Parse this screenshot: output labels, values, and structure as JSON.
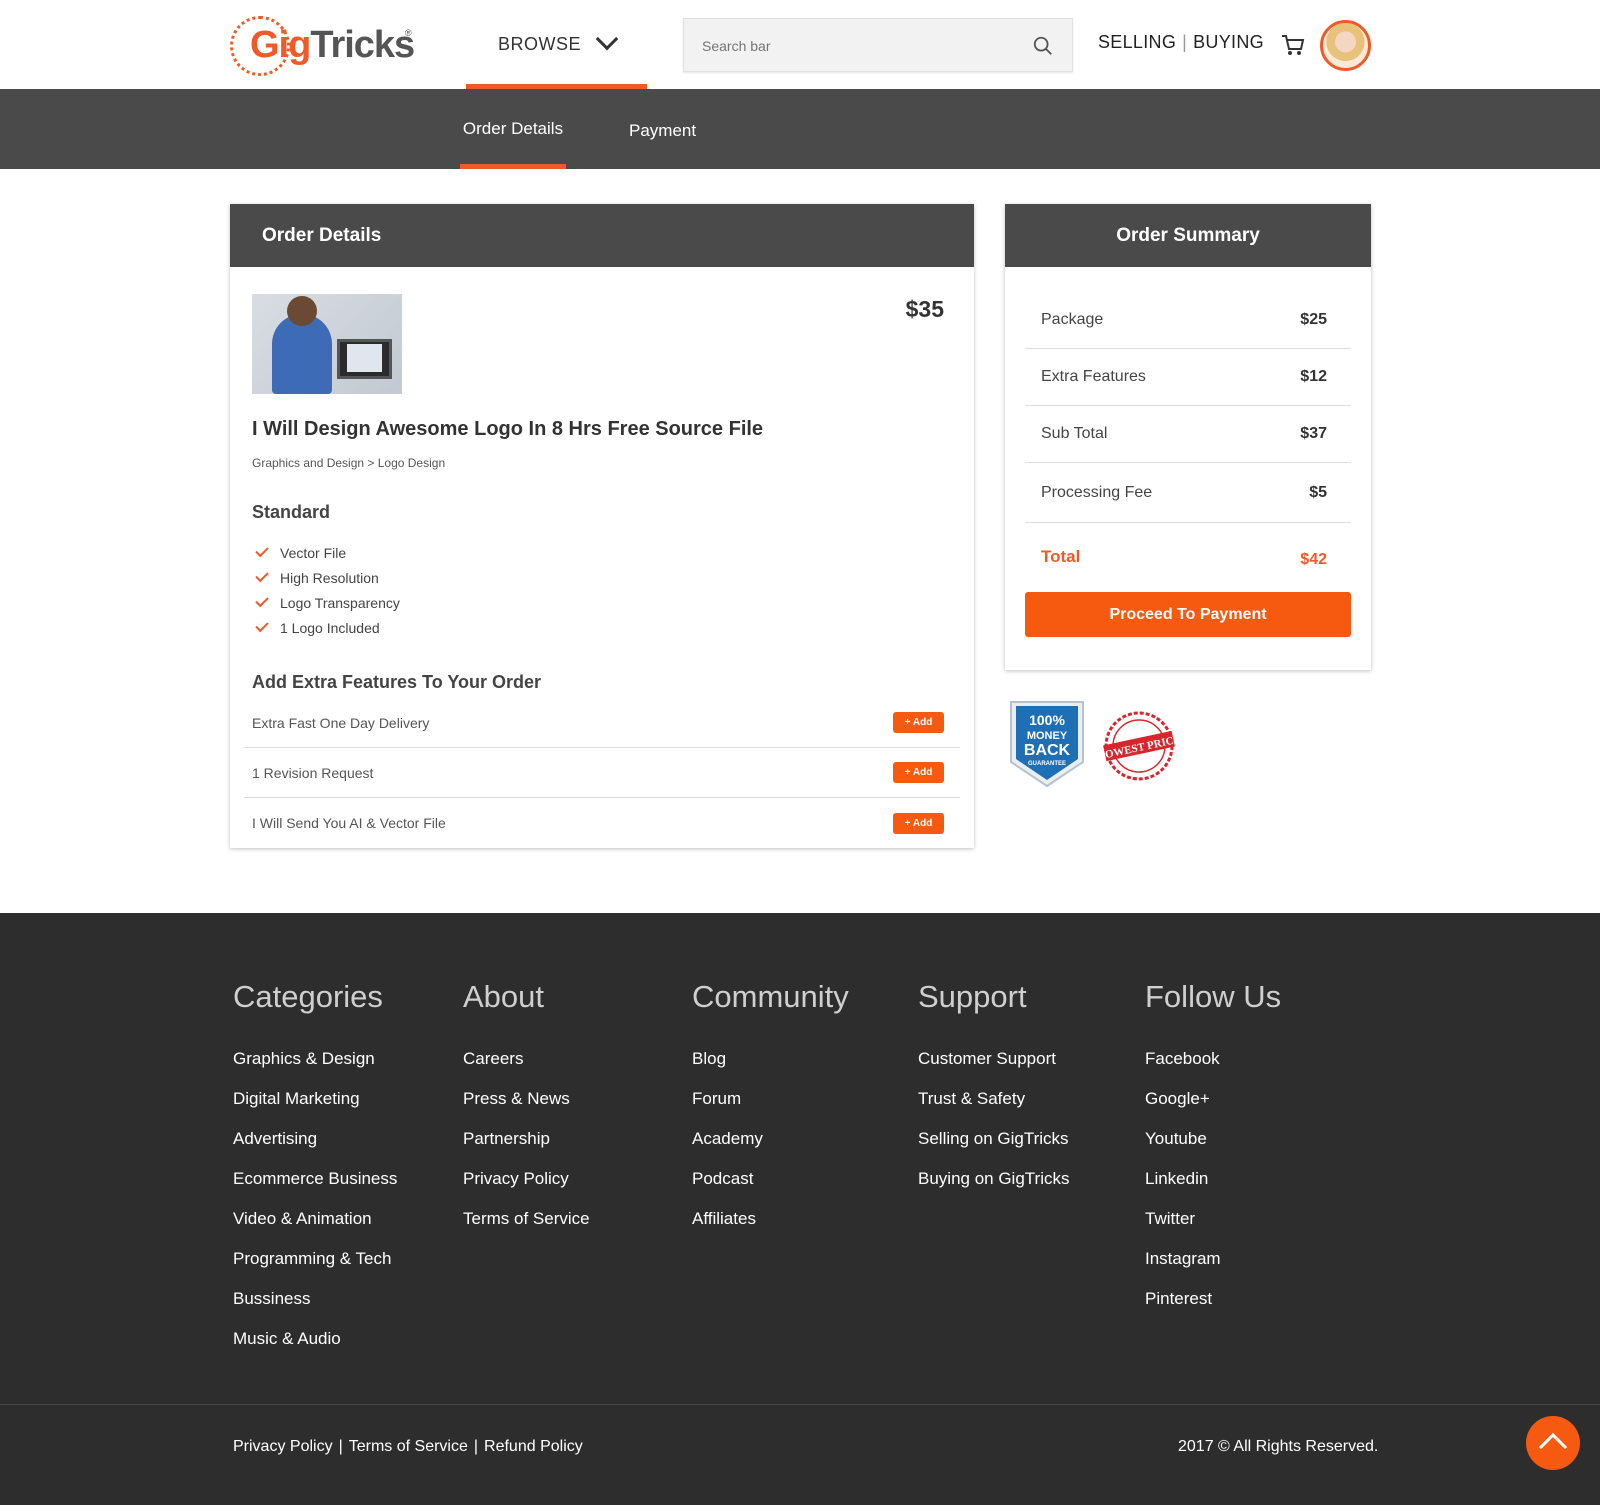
{
  "header": {
    "logo": {
      "part1": "Gig",
      "part2": "Tricks",
      "reg": "®"
    },
    "browse_label": "BROWSE",
    "search_placeholder": "Search bar",
    "selling_label": "SELLING",
    "separator": "|",
    "buying_label": "BUYING",
    "icons": [
      "chevron-down-icon",
      "search-icon",
      "cart-icon"
    ]
  },
  "tabs": [
    {
      "label": "Order Details",
      "active": true
    },
    {
      "label": "Payment",
      "active": false
    }
  ],
  "order_details": {
    "heading": "Order Details",
    "price": "$35",
    "gig_title": "I Will Design Awesome Logo In 8 Hrs Free Source File",
    "category_path": "Graphics and Design > Logo Design",
    "package_name": "Standard",
    "features": [
      "Vector File",
      "High Resolution",
      "Logo Transparency",
      "1 Logo Included"
    ],
    "extras_heading": "Add Extra Features To Your Order",
    "extras": [
      {
        "label": "Extra Fast One Day Delivery",
        "button": "+ Add"
      },
      {
        "label": "1 Revision Request",
        "button": "+ Add"
      },
      {
        "label": "I Will Send You AI & Vector File",
        "button": "+ Add"
      }
    ]
  },
  "order_summary": {
    "heading": "Order Summary",
    "rows": [
      {
        "label": "Package",
        "value": "$25"
      },
      {
        "label": "Extra Features",
        "value": "$12"
      },
      {
        "label": "Sub Total",
        "value": "$37"
      },
      {
        "label": "Processing Fee",
        "value": "$5"
      }
    ],
    "total_label": "Total",
    "total_value": "$42",
    "proceed_label": "Proceed To Payment"
  },
  "badges": {
    "money_back": [
      "100%",
      "MONEY",
      "BACK",
      "GUARANTEE"
    ],
    "lowest_price": "LOWEST PRICE"
  },
  "footer": {
    "columns": [
      {
        "title": "Categories",
        "links": [
          "Graphics & Design",
          "Digital Marketing",
          "Advertising",
          "Ecommerce Business",
          "Video & Animation",
          "Programming & Tech",
          "Bussiness",
          "Music & Audio"
        ]
      },
      {
        "title": "About",
        "links": [
          "Careers",
          "Press & News",
          "Partnership",
          "Privacy Policy",
          "Terms of Service"
        ]
      },
      {
        "title": "Community",
        "links": [
          "Blog",
          "Forum",
          "Academy",
          "Podcast",
          "Affiliates"
        ]
      },
      {
        "title": "Support",
        "links": [
          "Customer Support",
          "Trust & Safety",
          "Selling on GigTricks",
          "Buying on GigTricks"
        ]
      },
      {
        "title": "Follow Us",
        "links": [
          "Facebook",
          "Google+",
          "Youtube",
          "Linkedin",
          "Twitter",
          "Instagram",
          "Pinterest"
        ]
      }
    ],
    "legal_links": [
      "Privacy Policy",
      "Terms of Service",
      "Refund Policy"
    ],
    "legal_separator": "|",
    "copyright": "2017 © All Rights Reserved."
  },
  "colors": {
    "accent": "#f05a28",
    "button": "#f55a10",
    "dark": "#4a4a4a",
    "footer": "#2d2d2d"
  }
}
